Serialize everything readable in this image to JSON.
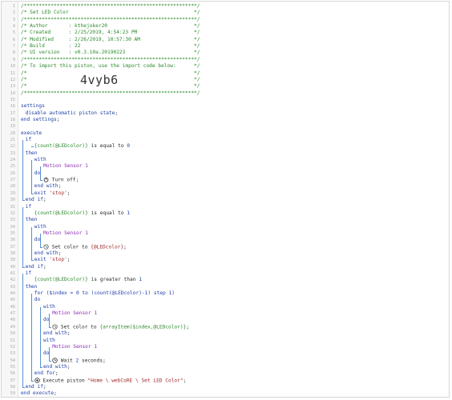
{
  "editor": {
    "lines": [
      {
        "n": "1",
        "parts": [
          {
            "t": "/**********************************************************/",
            "c": "c-comment"
          }
        ],
        "ind": 0
      },
      {
        "n": "2",
        "parts": [
          {
            "t": "/* Set LED Color                                          */",
            "c": "c-comment"
          }
        ],
        "ind": 0
      },
      {
        "n": "3",
        "parts": [
          {
            "t": "/**********************************************************/",
            "c": "c-comment"
          }
        ],
        "ind": 0
      },
      {
        "n": "4",
        "parts": [
          {
            "t": "/* Author       : kthejoker20                             */",
            "c": "c-comment"
          }
        ],
        "ind": 0
      },
      {
        "n": "5",
        "parts": [
          {
            "t": "/* Created      : 2/25/2019, 4:54:23 PM                   */",
            "c": "c-comment"
          }
        ],
        "ind": 0
      },
      {
        "n": "6",
        "parts": [
          {
            "t": "/* Modified     : 2/26/2019, 10:57:30 AM                  */",
            "c": "c-comment"
          }
        ],
        "ind": 0
      },
      {
        "n": "7",
        "parts": [
          {
            "t": "/* Build        : 22                                      */",
            "c": "c-comment"
          }
        ],
        "ind": 0
      },
      {
        "n": "8",
        "parts": [
          {
            "t": "/* UI version   : v0.3.10a.20190223                       */",
            "c": "c-comment"
          }
        ],
        "ind": 0
      },
      {
        "n": "9",
        "parts": [
          {
            "t": "/**********************************************************/",
            "c": "c-comment"
          }
        ],
        "ind": 0
      },
      {
        "n": "10",
        "parts": [
          {
            "t": "/* To import this piston, use the import code below:      */",
            "c": "c-comment"
          }
        ],
        "ind": 0
      },
      {
        "n": "11",
        "parts": [
          {
            "t": "/*                                                        */",
            "c": "c-comment"
          }
        ],
        "ind": 0
      },
      {
        "n": "12",
        "parts": [
          {
            "t": "/*                                                        */",
            "c": "c-comment"
          }
        ],
        "ind": 0
      },
      {
        "n": "13",
        "parts": [
          {
            "t": "/*                                                        */",
            "c": "c-comment"
          }
        ],
        "ind": 0
      },
      {
        "n": "14",
        "parts": [
          {
            "t": "/**********************************************************/",
            "c": "c-comment"
          }
        ],
        "ind": 0
      },
      {
        "n": "15",
        "parts": [],
        "ind": 0
      },
      {
        "n": "16",
        "parts": [
          {
            "t": "settings",
            "c": "c-kw"
          }
        ],
        "ind": 0
      },
      {
        "n": "17",
        "parts": [
          {
            "t": "disable automatic piston state",
            "c": "c-kw"
          },
          {
            "t": ";",
            "c": "c-text"
          }
        ],
        "ind": 1
      },
      {
        "n": "18",
        "parts": [
          {
            "t": "end settings",
            "c": "c-kw"
          },
          {
            "t": ";",
            "c": "c-text"
          }
        ],
        "ind": 0
      },
      {
        "n": "19",
        "parts": [],
        "ind": 0
      },
      {
        "n": "20",
        "parts": [
          {
            "t": "execute",
            "c": "c-kw"
          }
        ],
        "ind": 0
      },
      {
        "n": "21",
        "parts": [
          {
            "t": "if",
            "c": "c-kw"
          }
        ],
        "ind": 1
      },
      {
        "n": "22",
        "parts": [
          {
            "t": "{count(@LEDcolor)}",
            "c": "c-expr"
          },
          {
            "t": " is equal to ",
            "c": "c-text"
          },
          {
            "t": "0",
            "c": "c-num"
          }
        ],
        "ind": 3
      },
      {
        "n": "23",
        "parts": [
          {
            "t": "then",
            "c": "c-kw"
          }
        ],
        "ind": 1
      },
      {
        "n": "24",
        "parts": [
          {
            "t": "with",
            "c": "c-kw"
          }
        ],
        "ind": 3
      },
      {
        "n": "25",
        "parts": [
          {
            "t": "Motion Sensor 1",
            "c": "c-dev"
          }
        ],
        "ind": 5
      },
      {
        "n": "26",
        "parts": [
          {
            "t": "do",
            "c": "c-kw"
          }
        ],
        "ind": 3
      },
      {
        "n": "27",
        "parts": [
          {
            "t": "ICON:power",
            "c": ""
          },
          {
            "t": " Turn off",
            "c": "c-text"
          },
          {
            "t": ";",
            "c": "c-text"
          }
        ],
        "ind": 5
      },
      {
        "n": "28",
        "parts": [
          {
            "t": "end with",
            "c": "c-kw"
          },
          {
            "t": ";",
            "c": "c-text"
          }
        ],
        "ind": 3
      },
      {
        "n": "29",
        "parts": [
          {
            "t": "exit ",
            "c": "c-kw"
          },
          {
            "t": "'stop'",
            "c": "c-str"
          },
          {
            "t": ";",
            "c": "c-text"
          }
        ],
        "ind": 3
      },
      {
        "n": "30",
        "parts": [
          {
            "t": "end if",
            "c": "c-kw"
          },
          {
            "t": ";",
            "c": "c-text"
          }
        ],
        "ind": 1
      },
      {
        "n": "31",
        "parts": [
          {
            "t": "if",
            "c": "c-kw"
          }
        ],
        "ind": 1
      },
      {
        "n": "32",
        "parts": [
          {
            "t": "{count(@LEDcolor)}",
            "c": "c-expr"
          },
          {
            "t": " is equal to ",
            "c": "c-text"
          },
          {
            "t": "1",
            "c": "c-num"
          }
        ],
        "ind": 3
      },
      {
        "n": "33",
        "parts": [
          {
            "t": "then",
            "c": "c-kw"
          }
        ],
        "ind": 1
      },
      {
        "n": "34",
        "parts": [
          {
            "t": "with",
            "c": "c-kw"
          }
        ],
        "ind": 3
      },
      {
        "n": "35",
        "parts": [
          {
            "t": "Motion Sensor 1",
            "c": "c-dev"
          }
        ],
        "ind": 5
      },
      {
        "n": "36",
        "parts": [
          {
            "t": "do",
            "c": "c-kw"
          }
        ],
        "ind": 3
      },
      {
        "n": "37",
        "parts": [
          {
            "t": "ICON:palette",
            "c": ""
          },
          {
            "t": " Set color to ",
            "c": "c-text"
          },
          {
            "t": "{@LEDcolor}",
            "c": "c-var"
          },
          {
            "t": ";",
            "c": "c-text"
          }
        ],
        "ind": 5
      },
      {
        "n": "38",
        "parts": [
          {
            "t": "end with",
            "c": "c-kw"
          },
          {
            "t": ";",
            "c": "c-text"
          }
        ],
        "ind": 3
      },
      {
        "n": "39",
        "parts": [
          {
            "t": "exit ",
            "c": "c-kw"
          },
          {
            "t": "'stop'",
            "c": "c-str"
          },
          {
            "t": ";",
            "c": "c-text"
          }
        ],
        "ind": 3
      },
      {
        "n": "40",
        "parts": [
          {
            "t": "end if",
            "c": "c-kw"
          },
          {
            "t": ";",
            "c": "c-text"
          }
        ],
        "ind": 1
      },
      {
        "n": "41",
        "parts": [
          {
            "t": "if",
            "c": "c-kw"
          }
        ],
        "ind": 1
      },
      {
        "n": "42",
        "parts": [
          {
            "t": "{count(@LEDcolor)}",
            "c": "c-expr"
          },
          {
            "t": " is greater than ",
            "c": "c-text"
          },
          {
            "t": "1",
            "c": "c-num"
          }
        ],
        "ind": 3
      },
      {
        "n": "43",
        "parts": [
          {
            "t": "then",
            "c": "c-kw"
          }
        ],
        "ind": 1
      },
      {
        "n": "44",
        "parts": [
          {
            "t": "for ($index = ",
            "c": "c-kw"
          },
          {
            "t": "0",
            "c": "c-num"
          },
          {
            "t": " to (count(@LEDcolor)-1) step ",
            "c": "c-kw"
          },
          {
            "t": "1",
            "c": "c-num"
          },
          {
            "t": ")",
            "c": "c-kw"
          }
        ],
        "ind": 3
      },
      {
        "n": "45",
        "parts": [
          {
            "t": "do",
            "c": "c-kw"
          }
        ],
        "ind": 3
      },
      {
        "n": "46",
        "parts": [
          {
            "t": "with",
            "c": "c-kw"
          }
        ],
        "ind": 5
      },
      {
        "n": "47",
        "parts": [
          {
            "t": "Motion Sensor 1",
            "c": "c-dev"
          }
        ],
        "ind": 7
      },
      {
        "n": "48",
        "parts": [
          {
            "t": "do",
            "c": "c-kw"
          }
        ],
        "ind": 5
      },
      {
        "n": "49",
        "parts": [
          {
            "t": "ICON:palette",
            "c": ""
          },
          {
            "t": " Set color to ",
            "c": "c-text"
          },
          {
            "t": "{arrayItem($index,@LEDcolor)}",
            "c": "c-expr"
          },
          {
            "t": ";",
            "c": "c-text"
          }
        ],
        "ind": 7
      },
      {
        "n": "50",
        "parts": [
          {
            "t": "end with",
            "c": "c-kw"
          },
          {
            "t": ";",
            "c": "c-text"
          }
        ],
        "ind": 5
      },
      {
        "n": "51",
        "parts": [
          {
            "t": "with",
            "c": "c-kw"
          }
        ],
        "ind": 5
      },
      {
        "n": "52",
        "parts": [
          {
            "t": "Motion Sensor 1",
            "c": "c-dev"
          }
        ],
        "ind": 7
      },
      {
        "n": "53",
        "parts": [
          {
            "t": "do",
            "c": "c-kw"
          }
        ],
        "ind": 5
      },
      {
        "n": "54",
        "parts": [
          {
            "t": "ICON:clock",
            "c": ""
          },
          {
            "t": " Wait ",
            "c": "c-text"
          },
          {
            "t": "2",
            "c": "c-num"
          },
          {
            "t": " seconds",
            "c": "c-text"
          },
          {
            "t": ";",
            "c": "c-text"
          }
        ],
        "ind": 7
      },
      {
        "n": "55",
        "parts": [
          {
            "t": "end with",
            "c": "c-kw"
          },
          {
            "t": ";",
            "c": "c-text"
          }
        ],
        "ind": 5
      },
      {
        "n": "56",
        "parts": [
          {
            "t": "end for",
            "c": "c-kw"
          },
          {
            "t": ";",
            "c": "c-text"
          }
        ],
        "ind": 3
      },
      {
        "n": "57",
        "parts": [
          {
            "t": "ICON:piston",
            "c": ""
          },
          {
            "t": " Execute piston ",
            "c": "c-text"
          },
          {
            "t": "\"Home \\ webCoRE \\ Set LED Color\"",
            "c": "c-str"
          },
          {
            "t": ";",
            "c": "c-text"
          }
        ],
        "ind": 3
      },
      {
        "n": "58",
        "parts": [
          {
            "t": "end if",
            "c": "c-kw"
          },
          {
            "t": ";",
            "c": "c-text"
          }
        ],
        "ind": 1
      },
      {
        "n": "59",
        "parts": [
          {
            "t": "end execute",
            "c": "c-kw"
          },
          {
            "t": ";",
            "c": "c-text"
          }
        ],
        "ind": 0
      }
    ],
    "import_code": "4vyb6"
  },
  "icons": {
    "power": "power-icon",
    "palette": "palette-icon",
    "clock": "clock-icon",
    "piston": "piston-icon"
  },
  "colors": {
    "comment": "#2b8a2b",
    "keyword": "#1f3fa8",
    "device": "#8b2bb5",
    "string": "#a12b2b",
    "guide": "#5a8fd0"
  }
}
